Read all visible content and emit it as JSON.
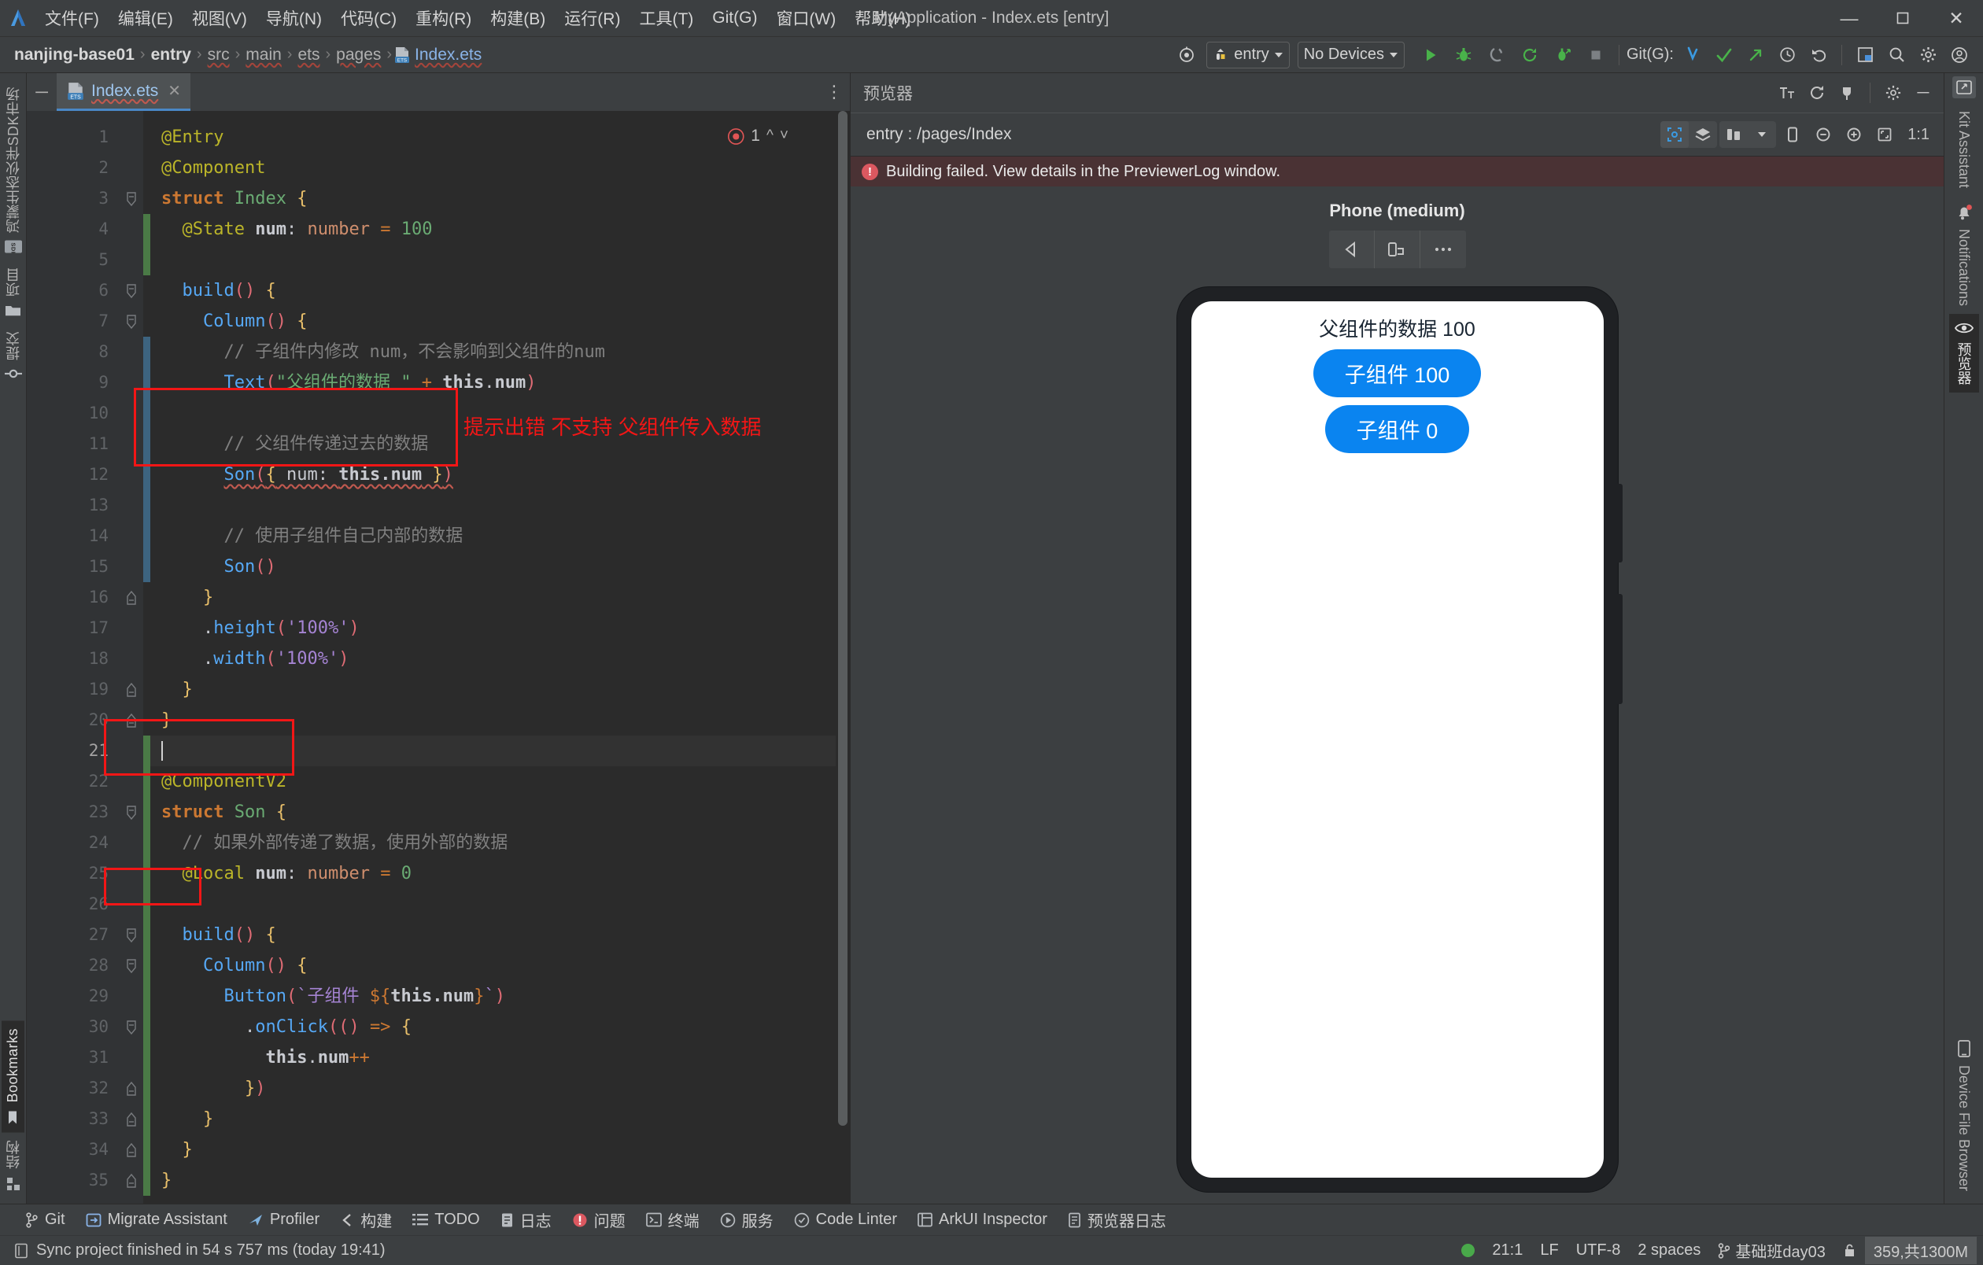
{
  "window": {
    "title": "MyApplication - Index.ets [entry]",
    "controls": {
      "minimize": "—",
      "maximize": "❐",
      "close": "✕"
    }
  },
  "menu": {
    "items": [
      {
        "label": "文件(F)",
        "name": "menu-file"
      },
      {
        "label": "编辑(E)",
        "name": "menu-edit"
      },
      {
        "label": "视图(V)",
        "name": "menu-view"
      },
      {
        "label": "导航(N)",
        "name": "menu-navigate"
      },
      {
        "label": "代码(C)",
        "name": "menu-code"
      },
      {
        "label": "重构(R)",
        "name": "menu-refactor"
      },
      {
        "label": "构建(B)",
        "name": "menu-build"
      },
      {
        "label": "运行(R)",
        "name": "menu-run"
      },
      {
        "label": "工具(T)",
        "name": "menu-tools"
      },
      {
        "label": "Git(G)",
        "name": "menu-git"
      },
      {
        "label": "窗口(W)",
        "name": "menu-window"
      },
      {
        "label": "帮助(H)",
        "name": "menu-help"
      }
    ]
  },
  "breadcrumb": {
    "segments": [
      "nanjing-base01",
      "entry",
      "src",
      "main",
      "ets",
      "pages"
    ],
    "file": "Index.ets",
    "separator": "›"
  },
  "toolbar": {
    "run_config": "entry",
    "device": "No Devices",
    "git_label": "Git(G):",
    "icons": [
      "target-icon",
      "run-icon",
      "debug-icon",
      "coverage-icon",
      "rerun-icon",
      "profile-icon",
      "stop-icon",
      "git-update-icon",
      "git-commit-icon",
      "git-push-icon",
      "history-icon",
      "rollback-icon",
      "layout-icon",
      "search-icon",
      "settings-icon",
      "account-icon"
    ]
  },
  "left_strip": {
    "items": [
      {
        "label": "鸿蒙生态伙伴SDK市场",
        "icon": "sdk-icon",
        "name": "sidebar-tab-sdk-market"
      },
      {
        "label": "项目",
        "icon": "folder-icon",
        "name": "sidebar-tab-project"
      },
      {
        "label": "提交",
        "icon": "commit-icon",
        "name": "sidebar-tab-commit"
      },
      {
        "label": "Bookmarks",
        "icon": "bookmark-icon",
        "name": "sidebar-tab-bookmarks"
      },
      {
        "label": "结构",
        "icon": "structure-icon",
        "name": "sidebar-tab-structure"
      }
    ]
  },
  "right_strip": {
    "items": [
      {
        "label": "Kit Assistant",
        "icon": "kit-assistant-icon",
        "name": "sidebar-tab-kit-assistant"
      },
      {
        "label": "Notifications",
        "icon": "bell-icon",
        "name": "sidebar-tab-notifications"
      },
      {
        "label": "预览器",
        "icon": "eye-icon",
        "name": "sidebar-tab-previewer"
      },
      {
        "label": "Device File Browser",
        "icon": "device-file-icon",
        "name": "sidebar-tab-device-file-browser"
      }
    ]
  },
  "editor": {
    "tab": {
      "label": "Index.ets",
      "icon": "ets-file-icon",
      "close": "✕"
    },
    "error_count": "1",
    "caret_position": "21:1",
    "lines": [
      {
        "n": 1,
        "html": "<span class='deco'>@Entry</span>"
      },
      {
        "n": 2,
        "html": "<span class='deco'>@Component</span>"
      },
      {
        "n": 3,
        "html": "<span class='kw bold'>struct</span> <span class='type'>Index</span> <span class='brace'>{</span>"
      },
      {
        "n": 4,
        "html": "  <span class='deco'>@State</span> <span class='id bold'>num</span><span class='id'>:</span> <span class='kw2'>number</span> <span class='op'>=</span> <span class='num'>100</span>"
      },
      {
        "n": 5,
        "html": ""
      },
      {
        "n": 6,
        "html": "  <span class='fn'>build</span><span class='paren'>()</span> <span class='brace'>{</span>"
      },
      {
        "n": 7,
        "html": "    <span class='fn'>Column</span><span class='paren'>()</span> <span class='brace'>{</span>"
      },
      {
        "n": 8,
        "html": "      <span class='cm'>// 子组件内修改 num，不会影响到父组件的num</span>"
      },
      {
        "n": 9,
        "html": "      <span class='fn'>Text</span><span class='paren'>(</span><span class='str'>\"父组件的数据 \"</span> <span class='op'>+</span> <span class='id bold'>this</span><span class='id'>.</span><span class='id bold'>num</span><span class='paren'>)</span>"
      },
      {
        "n": 10,
        "html": ""
      },
      {
        "n": 11,
        "html": "      <span class='cm'>// 父组件传递过去的数据</span>"
      },
      {
        "n": 12,
        "html": "      <span class='fn sq'>Son</span><span class='paren sq'>(</span><span class='brace sq'>{</span><span class='id sq'> num: </span><span class='id bold sq'>this.num</span><span class='brace sq'> }</span><span class='paren sq'>)</span>"
      },
      {
        "n": 13,
        "html": ""
      },
      {
        "n": 14,
        "html": "      <span class='cm'>// 使用子组件自己内部的数据</span>"
      },
      {
        "n": 15,
        "html": "      <span class='fn'>Son</span><span class='paren'>()</span>"
      },
      {
        "n": 16,
        "html": "    <span class='brace'>}</span>"
      },
      {
        "n": 17,
        "html": "    <span class='id'>.</span><span class='fn'>height</span><span class='paren'>(</span><span class='strpur'>'100%'</span><span class='paren'>)</span>"
      },
      {
        "n": 18,
        "html": "    <span class='id'>.</span><span class='fn'>width</span><span class='paren'>(</span><span class='strpur'>'100%'</span><span class='paren'>)</span>"
      },
      {
        "n": 19,
        "html": "  <span class='brace'>}</span>"
      },
      {
        "n": 20,
        "html": "<span class='brace'>}</span>"
      },
      {
        "n": 21,
        "html": ""
      },
      {
        "n": 22,
        "html": "<span class='deco'>@ComponentV2</span>"
      },
      {
        "n": 23,
        "html": "<span class='kw bold'>struct</span> <span class='type'>Son</span> <span class='brace'>{</span>"
      },
      {
        "n": 24,
        "html": "  <span class='cm'>// 如果外部传递了数据，使用外部的数据</span>"
      },
      {
        "n": 25,
        "html": "  <span class='deco'>@Local</span> <span class='id bold'>num</span><span class='id'>:</span> <span class='kw2'>number</span> <span class='op'>=</span> <span class='num'>0</span>"
      },
      {
        "n": 26,
        "html": ""
      },
      {
        "n": 27,
        "html": "  <span class='fn'>build</span><span class='paren'>()</span> <span class='brace'>{</span>"
      },
      {
        "n": 28,
        "html": "    <span class='fn'>Column</span><span class='paren'>()</span> <span class='brace'>{</span>"
      },
      {
        "n": 29,
        "html": "      <span class='fn'>Button</span><span class='paren'>(</span><span class='strpur'>`子组件 </span><span class='op'>${</span><span class='id bold'>this.num</span><span class='op'>}</span><span class='strpur'>`</span><span class='paren'>)</span>"
      },
      {
        "n": 30,
        "html": "        <span class='id'>.</span><span class='fn'>onClick</span><span class='paren'>((</span><span class='paren'>)</span> <span class='op'>=&gt;</span> <span class='brace'>{</span>"
      },
      {
        "n": 31,
        "html": "          <span class='id bold'>this</span><span class='id'>.</span><span class='id bold'>num</span><span class='op'>++</span>"
      },
      {
        "n": 32,
        "html": "        <span class='brace'>}</span><span class='paren'>)</span>"
      },
      {
        "n": 33,
        "html": "    <span class='brace'>}</span>"
      },
      {
        "n": 34,
        "html": "  <span class='brace'>}</span>"
      },
      {
        "n": 35,
        "html": "<span class='brace'>}</span>"
      }
    ],
    "annotation": "提示出错 不支持 父组件传入数据"
  },
  "preview": {
    "panel_title": "预览器",
    "path": "entry : /pages/Index",
    "error": "Building failed. View details in the PreviewerLog window.",
    "device_name": "Phone (medium)",
    "zoom_ratio": "1:1",
    "device_tools": [
      "back-icon",
      "rotate-icon",
      "more-icon"
    ],
    "screen": {
      "parent_text": "父组件的数据 100",
      "button_1": "子组件 100",
      "button_2": "子组件 0",
      "button_color": "#0a84f0"
    }
  },
  "tool_windows": [
    {
      "label": "Git",
      "icon": "git-icon",
      "name": "toolwindow-git"
    },
    {
      "label": "Migrate Assistant",
      "icon": "migrate-icon",
      "name": "toolwindow-migrate-assistant"
    },
    {
      "label": "Profiler",
      "icon": "profiler-icon",
      "name": "toolwindow-profiler"
    },
    {
      "label": "构建",
      "icon": "build-icon",
      "name": "toolwindow-build"
    },
    {
      "label": "TODO",
      "icon": "todo-icon",
      "name": "toolwindow-todo"
    },
    {
      "label": "日志",
      "icon": "log-icon",
      "name": "toolwindow-log"
    },
    {
      "label": "问题",
      "icon": "problems-icon",
      "name": "toolwindow-problems"
    },
    {
      "label": "终端",
      "icon": "terminal-icon",
      "name": "toolwindow-terminal"
    },
    {
      "label": "服务",
      "icon": "services-icon",
      "name": "toolwindow-services"
    },
    {
      "label": "Code Linter",
      "icon": "linter-icon",
      "name": "toolwindow-code-linter"
    },
    {
      "label": "ArkUI Inspector",
      "icon": "inspector-icon",
      "name": "toolwindow-arkui-inspector"
    },
    {
      "label": "预览器日志",
      "icon": "previewer-log-icon",
      "name": "toolwindow-previewer-log"
    }
  ],
  "statusbar": {
    "message": "Sync project finished in 54 s 757 ms (today 19:41)",
    "caret": "21:1",
    "line_sep": "LF",
    "encoding": "UTF-8",
    "indent": "2 spaces",
    "branch": "基础班day03",
    "memory": "359,共1300M"
  }
}
